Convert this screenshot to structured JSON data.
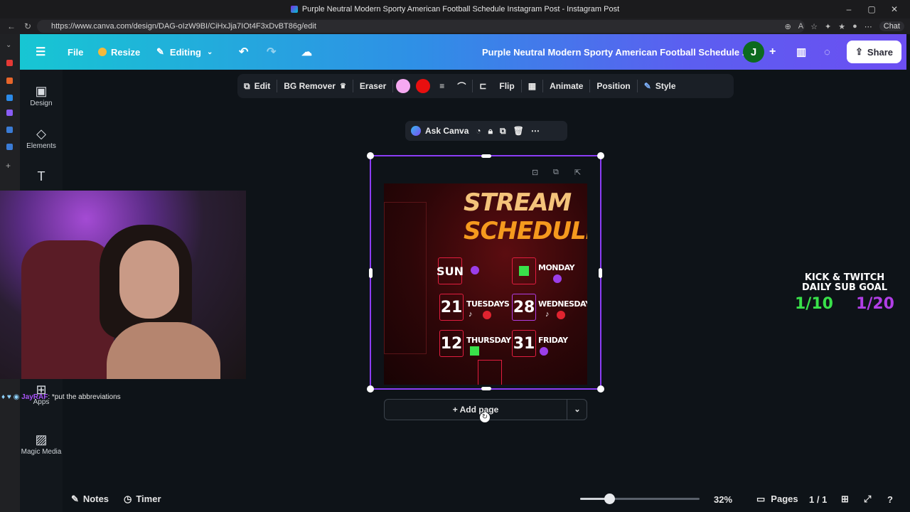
{
  "window": {
    "title": "Purple Neutral Modern Sporty American Football Schedule Instagram Post - Instagram Post",
    "controls": [
      "–",
      "▢",
      "✕"
    ]
  },
  "browser": {
    "url": "https://www.canva.com/design/DAG-oIzW9BI/CiHxJja7IOt4F3xDvBT86g/edit",
    "chat_label": "Chat"
  },
  "header": {
    "file_label": "File",
    "resize_label": "Resize",
    "editing_label": "Editing",
    "doc_title": "Purple Neutral Modern Sporty American Football Schedule ...",
    "avatar_letter": "J",
    "share_label": "Share"
  },
  "sidebar": {
    "items": [
      {
        "label": "Design",
        "icon": "layout-icon"
      },
      {
        "label": "Elements",
        "icon": "shapes-icon"
      },
      {
        "label": "Apps",
        "icon": "apps-icon"
      },
      {
        "label": "Magic Media",
        "icon": "magic-media-icon"
      }
    ]
  },
  "toolbar": {
    "edit": "Edit",
    "bg_remover": "BG Remover",
    "eraser": "Eraser",
    "colors": [
      "#f6a9f1",
      "#e80f0f"
    ],
    "flip": "Flip",
    "animate": "Animate",
    "position": "Position",
    "style": "Style"
  },
  "context": {
    "ask_canva": "Ask Canva"
  },
  "design": {
    "title_line1": "STREAM",
    "title_line2": "SCHEDULE",
    "days": [
      {
        "num": "SUN",
        "label": ""
      },
      {
        "num": "",
        "label": "MONDAY"
      },
      {
        "num": "21",
        "label": "TUESDAYS"
      },
      {
        "num": "28",
        "label": "WEDNESDAYS"
      },
      {
        "num": "12",
        "label": "THURSDAY"
      },
      {
        "num": "31",
        "label": "FRIDAY"
      }
    ]
  },
  "add_page": {
    "label": "+ Add page"
  },
  "overlay": {
    "goal_line1": "KICK & TWITCH",
    "goal_line2": "DAILY SUB GOAL",
    "kick_count": "1/10",
    "twitch_count": "1/20",
    "kick_color": "#39e14a",
    "twitch_color": "#b13ee6"
  },
  "chat": {
    "user": "JayRAF",
    "message": ": *put the abbreviations"
  },
  "bottom": {
    "notes": "Notes",
    "timer": "Timer",
    "zoom": "32%",
    "zoom_level": 0.32,
    "pages": "Pages",
    "page_count": "1 / 1"
  }
}
